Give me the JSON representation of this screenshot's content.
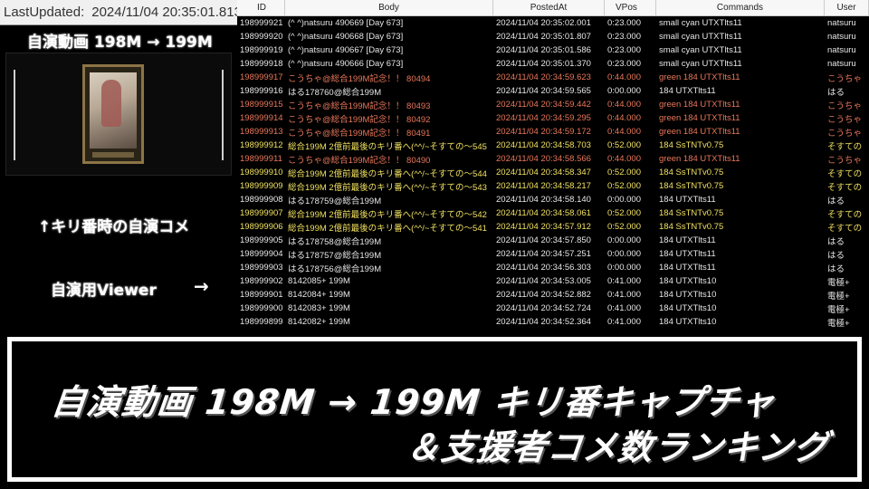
{
  "last_updated": {
    "label": "LastUpdated:",
    "value": "2024/11/04 20:35:01.813"
  },
  "left": {
    "title": "自演動画 198M → 199M",
    "caption_kiri": "↑キリ番時の自演コメ",
    "caption_viewer": "自演用Viewer",
    "viewer_arrow": "→"
  },
  "table": {
    "columns": [
      "ID",
      "Body",
      "PostedAt",
      "VPos",
      "Commands",
      "User"
    ],
    "rows": [
      {
        "id": "198999921",
        "body": "(^ ^)natsuru 490669 [Day 673]",
        "posted": "2024/11/04 20:35:02.001",
        "vpos": "0:23.000",
        "cmd": "small cyan UTXTlts11",
        "user": "natsuru",
        "color": "#e6e6e6"
      },
      {
        "id": "198999920",
        "body": "(^ ^)natsuru 490668 [Day 673]",
        "posted": "2024/11/04 20:35:01.807",
        "vpos": "0:23.000",
        "cmd": "small cyan UTXTlts11",
        "user": "natsuru",
        "color": "#e6e6e6"
      },
      {
        "id": "198999919",
        "body": "(^ ^)natsuru 490667 [Day 673]",
        "posted": "2024/11/04 20:35:01.586",
        "vpos": "0:23.000",
        "cmd": "small cyan UTXTlts11",
        "user": "natsuru",
        "color": "#e6e6e6"
      },
      {
        "id": "198999918",
        "body": "(^ ^)natsuru 490666 [Day 673]",
        "posted": "2024/11/04 20:35:01.370",
        "vpos": "0:23.000",
        "cmd": "small cyan UTXTlts11",
        "user": "natsuru",
        "color": "#e6e6e6"
      },
      {
        "id": "198999917",
        "body": "こうちゃ@総合199M記念！！ 80494",
        "posted": "2024/11/04 20:34:59.623",
        "vpos": "0:44.000",
        "cmd": "green 184 UTXTlts11",
        "user": "こうちゃ",
        "color": "#e8775a"
      },
      {
        "id": "198999916",
        "body": "はる178760@総合199M",
        "posted": "2024/11/04 20:34:59.565",
        "vpos": "0:00.000",
        "cmd": "184 UTXTlts11",
        "user": "はる",
        "color": "#e6e6e6"
      },
      {
        "id": "198999915",
        "body": "こうちゃ@総合199M記念！！ 80493",
        "posted": "2024/11/04 20:34:59.442",
        "vpos": "0:44.000",
        "cmd": "green 184 UTXTlts11",
        "user": "こうちゃ",
        "color": "#e8775a"
      },
      {
        "id": "198999914",
        "body": "こうちゃ@総合199M記念！！ 80492",
        "posted": "2024/11/04 20:34:59.295",
        "vpos": "0:44.000",
        "cmd": "green 184 UTXTlts11",
        "user": "こうちゃ",
        "color": "#e8775a"
      },
      {
        "id": "198999913",
        "body": "こうちゃ@総合199M記念！！ 80491",
        "posted": "2024/11/04 20:34:59.172",
        "vpos": "0:44.000",
        "cmd": "green 184 UTXTlts11",
        "user": "こうちゃ",
        "color": "#e8775a"
      },
      {
        "id": "198999912",
        "body": "総合199M 2億前最後のキリ番へ(^^/~そすての～545",
        "posted": "2024/11/04 20:34:58.703",
        "vpos": "0:52.000",
        "cmd": "184 SsTNTv0.75",
        "user": "そすての",
        "color": "#f0e060"
      },
      {
        "id": "198999911",
        "body": "こうちゃ@総合199M記念！！ 80490",
        "posted": "2024/11/04 20:34:58.566",
        "vpos": "0:44.000",
        "cmd": "green 184 UTXTlts11",
        "user": "こうちゃ",
        "color": "#e8775a"
      },
      {
        "id": "198999910",
        "body": "総合199M 2億前最後のキリ番へ(^^/~そすての～544",
        "posted": "2024/11/04 20:34:58.347",
        "vpos": "0:52.000",
        "cmd": "184 SsTNTv0.75",
        "user": "そすての",
        "color": "#f0e060"
      },
      {
        "id": "198999909",
        "body": "総合199M 2億前最後のキリ番へ(^^/~そすての～543",
        "posted": "2024/11/04 20:34:58.217",
        "vpos": "0:52.000",
        "cmd": "184 SsTNTv0.75",
        "user": "そすての",
        "color": "#f0e060"
      },
      {
        "id": "198999908",
        "body": "はる178759@総合199M",
        "posted": "2024/11/04 20:34:58.140",
        "vpos": "0:00.000",
        "cmd": "184 UTXTlts11",
        "user": "はる",
        "color": "#e6e6e6"
      },
      {
        "id": "198999907",
        "body": "総合199M 2億前最後のキリ番へ(^^/~そすての～542",
        "posted": "2024/11/04 20:34:58.061",
        "vpos": "0:52.000",
        "cmd": "184 SsTNTv0.75",
        "user": "そすての",
        "color": "#f0e060"
      },
      {
        "id": "198999906",
        "body": "総合199M 2億前最後のキリ番へ(^^/~そすての～541",
        "posted": "2024/11/04 20:34:57.912",
        "vpos": "0:52.000",
        "cmd": "184 SsTNTv0.75",
        "user": "そすての",
        "color": "#f0e060"
      },
      {
        "id": "198999905",
        "body": "はる178758@総合199M",
        "posted": "2024/11/04 20:34:57.850",
        "vpos": "0:00.000",
        "cmd": "184 UTXTlts11",
        "user": "はる",
        "color": "#e6e6e6"
      },
      {
        "id": "198999904",
        "body": "はる178757@総合199M",
        "posted": "2024/11/04 20:34:57.251",
        "vpos": "0:00.000",
        "cmd": "184 UTXTlts11",
        "user": "はる",
        "color": "#e6e6e6"
      },
      {
        "id": "198999903",
        "body": "はる178756@総合199M",
        "posted": "2024/11/04 20:34:56.303",
        "vpos": "0:00.000",
        "cmd": "184 UTXTlts11",
        "user": "はる",
        "color": "#e6e6e6"
      },
      {
        "id": "198999902",
        "body": "8142085+     199M",
        "posted": "2024/11/04 20:34:53.005",
        "vpos": "0:41.000",
        "cmd": "184 UTXTlts10",
        "user": "電極+",
        "color": "#e6e6e6"
      },
      {
        "id": "198999901",
        "body": "8142084+     199M",
        "posted": "2024/11/04 20:34:52.882",
        "vpos": "0:41.000",
        "cmd": "184 UTXTlts10",
        "user": "電極+",
        "color": "#e6e6e6"
      },
      {
        "id": "198999900",
        "body": "8142083+     199M",
        "posted": "2024/11/04 20:34:52.724",
        "vpos": "0:41.000",
        "cmd": "184 UTXTlts10",
        "user": "電極+",
        "color": "#e6e6e6"
      },
      {
        "id": "198999899",
        "body": "8142082+     199M",
        "posted": "2024/11/04 20:34:52.364",
        "vpos": "0:41.000",
        "cmd": "184 UTXTlts10",
        "user": "電極+",
        "color": "#e6e6e6"
      }
    ]
  },
  "banner": {
    "line1": "自演動画 198M → 199M キリ番キャプチャ",
    "line2": "＆支援者コメ数ランキング"
  },
  "colors": {
    "default_row": "#e6e6e6",
    "orange_row": "#e8775a",
    "yellow_row": "#f0e060"
  }
}
